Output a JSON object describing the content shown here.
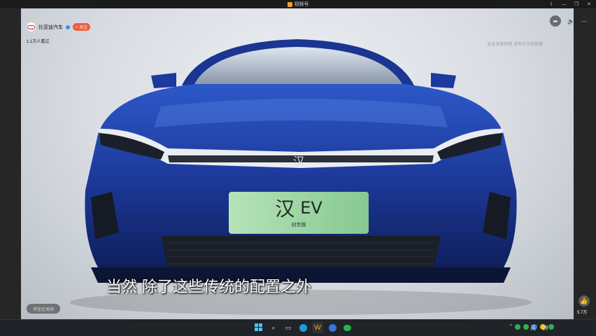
{
  "window": {
    "title": "视频号",
    "controls": [
      "⇩",
      "—",
      "❐",
      "✕"
    ]
  },
  "channel": {
    "name": "比亚迪汽车",
    "follow_label": "+ 关注",
    "views": "1.1万人看过"
  },
  "video": {
    "watermark": "安全驾驶阳明 请参中文驾驶路",
    "subtitle": "当然 除了这些传统的配置之外",
    "badge_text": "EV",
    "badge_sub": "创世版",
    "brand_glyph": "汉"
  },
  "comments": {
    "closed_label": "评论已关闭"
  },
  "likes": {
    "count": "5.7万"
  },
  "top_actions": {
    "share_icon": "share-icon",
    "volume_icon": "volume-icon",
    "more_icon": "more-icon"
  },
  "taskbar": {
    "lang": "英",
    "ime": "拼",
    "apps": [
      "windows-start-icon",
      "search-icon",
      "taskview-icon",
      "edge-icon",
      "channels-icon",
      "browser-icon",
      "wechat-icon"
    ]
  },
  "colors": {
    "car_blue": "#1f3fa0",
    "follow": "#f05a3a",
    "plate": "#9ed3a4"
  }
}
